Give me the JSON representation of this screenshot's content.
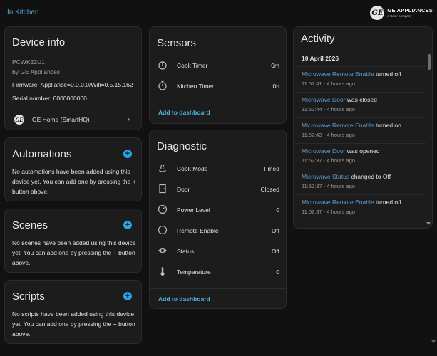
{
  "breadcrumb": "In Kitchen",
  "brand": {
    "name": "GE APPLIANCES",
    "sub": "a Haier company",
    "logo": "GE"
  },
  "device_info": {
    "title": "Device info",
    "model": "PCWK22U1",
    "manufacturer": "by GE Appliances",
    "firmware": "Firmware: Appliance=0.0.0.0/Wifi=0.5.15.162",
    "serial": "Serial number: 0000000000",
    "integration": {
      "label": "GE Home (SmartHQ)",
      "icon": "ge-logo-icon"
    }
  },
  "automations": {
    "title": "Automations",
    "empty": "No automations have been added using this device yet. You can add one by pressing the + button above."
  },
  "scenes": {
    "title": "Scenes",
    "empty": "No scenes have been added using this device yet. You can add one by pressing the + button above."
  },
  "scripts": {
    "title": "Scripts",
    "empty": "No scripts have been added using this device yet. You can add one by pressing the + button above."
  },
  "add_symbol": "+",
  "sensors": {
    "title": "Sensors",
    "rows": [
      {
        "label": "Cook Timer",
        "value": "0m",
        "icon": "timer-icon"
      },
      {
        "label": "Kitchen Timer",
        "value": "0h",
        "icon": "timer-icon"
      }
    ],
    "add_to_dashboard": "Add to dashboard"
  },
  "diagnostic": {
    "title": "Diagnostic",
    "rows": [
      {
        "label": "Cook Mode",
        "value": "Timed",
        "icon": "cook-mode-icon"
      },
      {
        "label": "Door",
        "value": "Closed",
        "icon": "door-icon"
      },
      {
        "label": "Power Level",
        "value": "0",
        "icon": "gauge-icon"
      },
      {
        "label": "Remote Enable",
        "value": "Off",
        "icon": "circle-icon"
      },
      {
        "label": "Status",
        "value": "Off",
        "icon": "eye-icon"
      },
      {
        "label": "Temperature",
        "value": "0",
        "icon": "thermometer-icon"
      }
    ],
    "add_to_dashboard": "Add to dashboard"
  },
  "activity": {
    "title": "Activity",
    "date": "10 April 2026",
    "items": [
      {
        "entity": "Microwave Remote Enable",
        "action": " turned off",
        "time": "11:57:41 - 4 hours ago"
      },
      {
        "entity": "Microwave Door",
        "action": " was closed",
        "time": "11:52:44 - 4 hours ago"
      },
      {
        "entity": "Microwave Remote Enable",
        "action": " turned on",
        "time": "11:52:43 - 4 hours ago"
      },
      {
        "entity": "Microwave Door",
        "action": " was opened",
        "time": "11:52:37 - 4 hours ago"
      },
      {
        "entity": "Microwave Status",
        "action": " changed to Off",
        "time": "11:52:37 - 4 hours ago"
      },
      {
        "entity": "Microwave Remote Enable",
        "action": " turned off",
        "time": "11:52:37 - 4 hours ago"
      }
    ]
  },
  "colors": {
    "accent": "#29a3e6",
    "link": "#4fb3e8",
    "entity": "#5b9bd1",
    "card": "#1c1c1c",
    "background": "#111111"
  }
}
